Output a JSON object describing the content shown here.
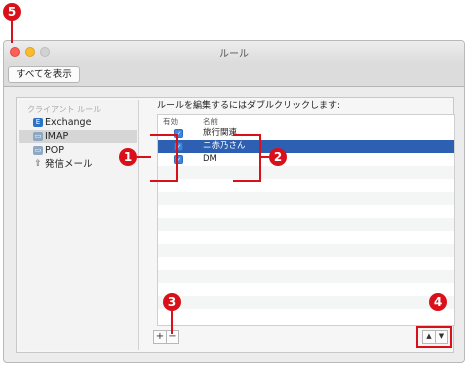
{
  "window": {
    "title": "ルール"
  },
  "toolbar": {
    "show_all_label": "すべてを表示"
  },
  "sidebar": {
    "header": "クライアント ルール",
    "items": [
      {
        "label": "Exchange",
        "icon": "exchange-icon",
        "selected": false
      },
      {
        "label": "IMAP",
        "icon": "imap-icon",
        "selected": true
      },
      {
        "label": "POP",
        "icon": "pop-icon",
        "selected": false
      },
      {
        "label": "発信メール",
        "icon": "outbox-icon",
        "selected": false
      }
    ]
  },
  "rules": {
    "caption": "ルールを編集するにはダブルクリックします:",
    "columns": [
      "有効",
      "名前"
    ],
    "rows": [
      {
        "enabled": true,
        "name": "旅行関連"
      },
      {
        "enabled": true,
        "name": "ニ赤乃さん",
        "selected": true
      },
      {
        "enabled": true,
        "name": "DM"
      }
    ]
  },
  "buttons": {
    "add": "+",
    "remove": "−",
    "move_up": "▲",
    "move_down": "▼"
  },
  "callouts": [
    "1",
    "2",
    "3",
    "4",
    "5"
  ],
  "colors": {
    "accent": "#2d5fb2",
    "callout": "#d90f1a"
  }
}
